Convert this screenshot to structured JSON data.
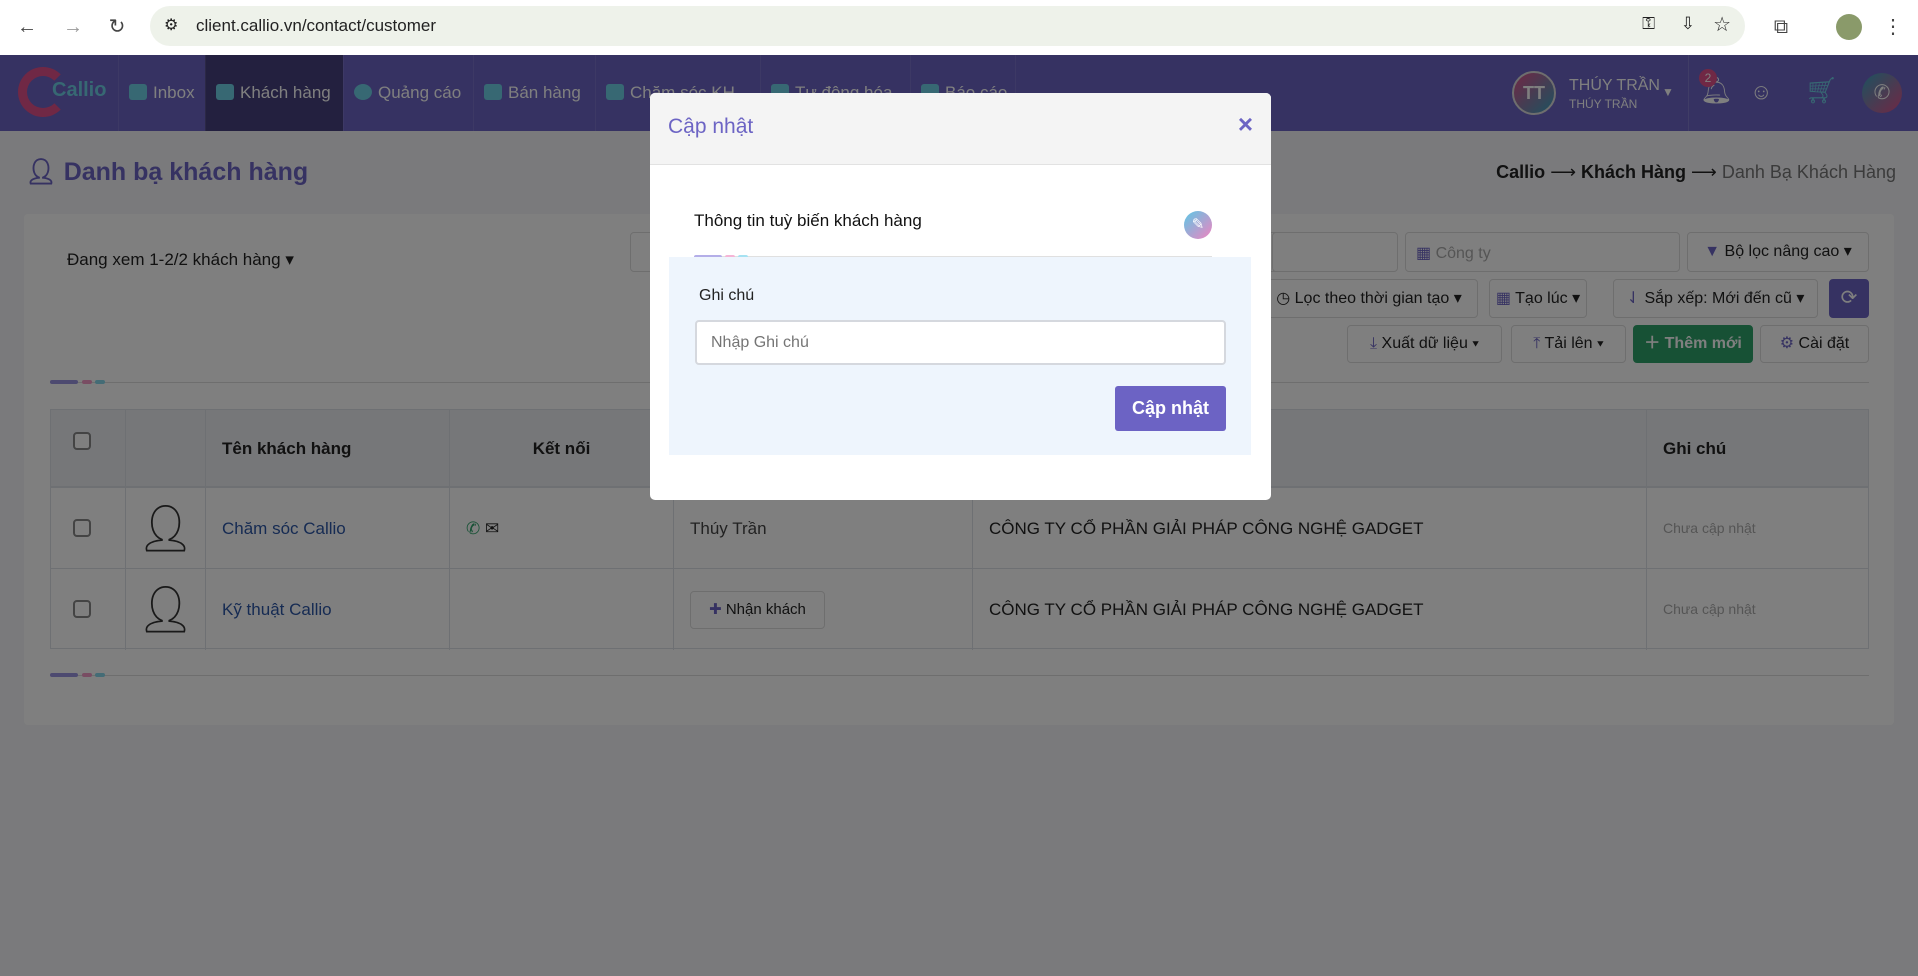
{
  "browser": {
    "url": "client.callio.vn/contact/customer"
  },
  "nav": {
    "logo": "Callio",
    "items": [
      {
        "label": "Inbox"
      },
      {
        "label": "Khách hàng"
      },
      {
        "label": "Quảng cáo"
      },
      {
        "label": "Bán hàng"
      },
      {
        "label": "Chăm sóc KH"
      },
      {
        "label": "Tự động hóa"
      },
      {
        "label": "Báo cáo"
      },
      {
        "label": "..."
      }
    ],
    "user": {
      "initials": "TT",
      "name": "THÚY TRẦN",
      "sub": "THÚY TRẦN"
    },
    "notifications": "2"
  },
  "page": {
    "title": "Danh bạ khách hàng",
    "breadcrumb": [
      "Callio",
      "Khách Hàng",
      "Danh Bạ Khách Hàng"
    ],
    "arrow": "⟶"
  },
  "toolbar": {
    "viewing": "Đang xem 1-2/2 khách hàng",
    "company_placeholder": "Công ty",
    "advanced_filter": "Bộ lọc nâng cao",
    "time_filter": "Lọc theo thời gian tạo",
    "created": "Tạo lúc",
    "sort": "Sắp xếp: Mới đến cũ",
    "export": "Xuất dữ liệu",
    "upload": "Tải lên",
    "add_new": "Thêm mới",
    "settings": "Cài đặt"
  },
  "table": {
    "headers": [
      "Tên khách hàng",
      "Kết nối",
      "",
      "",
      "Ghi chú"
    ],
    "rows": [
      {
        "name": "Chăm sóc Callio",
        "owner": "Thúy Trần",
        "company": "CÔNG TY CỔ PHẦN GIẢI PHÁP CÔNG NGHỆ GADGET",
        "note": "Chưa cập nhật"
      },
      {
        "name": "Kỹ thuật Callio",
        "owner_button": "Nhận khách",
        "company": "CÔNG TY CỔ PHẦN GIẢI PHÁP CÔNG NGHỆ GADGET",
        "note": "Chưa cập nhật"
      }
    ]
  },
  "modal": {
    "title": "Cập nhật",
    "close": "×",
    "section_title": "Thông tin tuỳ biến khách hàng",
    "field_label": "Ghi chú",
    "field_placeholder": "Nhập Ghi chú",
    "field_value": "",
    "submit": "Cập nhật"
  },
  "colors": {
    "brand": "#6c64c4",
    "primary_button": "#6c63c4",
    "success": "#2fa36b",
    "link": "#2d57a6"
  }
}
